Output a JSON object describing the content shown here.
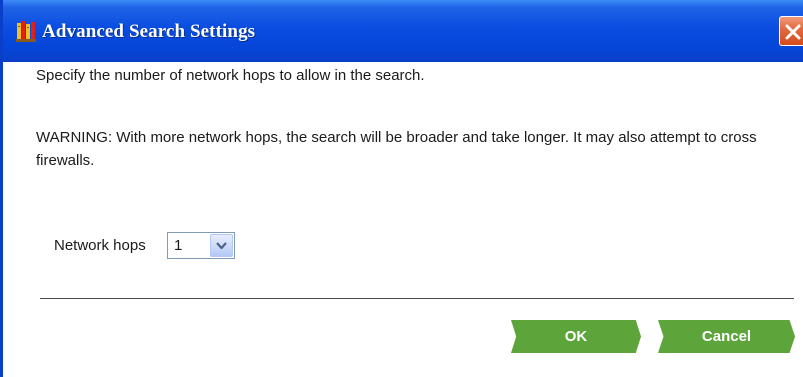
{
  "window": {
    "title": "Advanced Search Settings"
  },
  "content": {
    "instruction": "Specify the number of network hops to allow in the search.",
    "warning": "WARNING: With more network hops, the search will be broader and take longer. It may also attempt to cross firewalls."
  },
  "hops": {
    "label": "Network hops",
    "selected": "1"
  },
  "buttons": {
    "ok": "OK",
    "cancel": "Cancel"
  },
  "colors": {
    "titlebar": "#0a4de0",
    "button": "#5da53a",
    "close": "#d44b1c"
  }
}
